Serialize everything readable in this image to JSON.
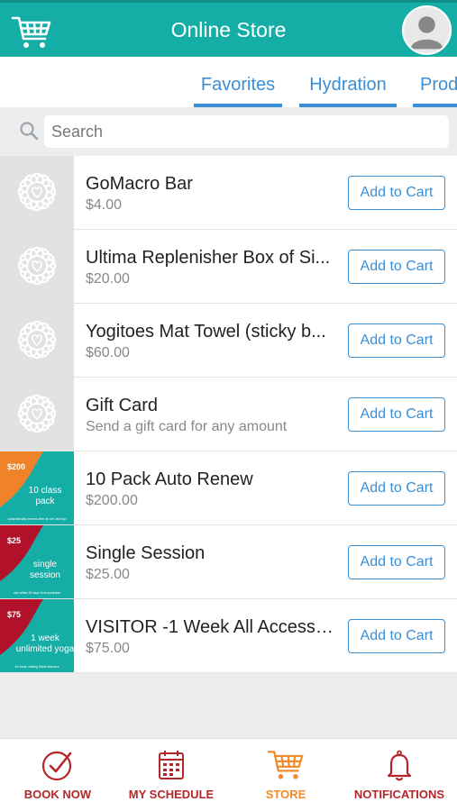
{
  "header": {
    "title": "Online Store"
  },
  "tabs": [
    {
      "label": "Favorites"
    },
    {
      "label": "Hydration"
    },
    {
      "label": "Prod"
    }
  ],
  "search": {
    "placeholder": "Search",
    "value": ""
  },
  "products": [
    {
      "name": "GoMacro Bar",
      "sub": "$4.00",
      "button": "Add to Cart",
      "thumb": "placeholder"
    },
    {
      "name": "Ultima Replenisher Box of Si...",
      "sub": "$20.00",
      "button": "Add to Cart",
      "thumb": "placeholder"
    },
    {
      "name": "Yogitoes Mat Towel (sticky b...",
      "sub": "$60.00",
      "button": "Add to Cart",
      "thumb": "placeholder"
    },
    {
      "name": "Gift Card",
      "sub": "Send a gift card for any amount",
      "button": "Add to Cart",
      "thumb": "placeholder"
    },
    {
      "name": "10 Pack Auto Renew",
      "sub": "$200.00",
      "button": "Add to Cart",
      "thumb": "promo",
      "promo": {
        "price": "$200",
        "line1": "10 class",
        "line2": "pack",
        "fine": "automatically renews after all are used up",
        "accent": "#f0822a"
      }
    },
    {
      "name": "Single Session",
      "sub": "$25.00",
      "button": "Add to Cart",
      "thumb": "promo",
      "promo": {
        "price": "$25",
        "line1": "single",
        "line2": "session",
        "fine": "use within 30 days from purchase",
        "accent": "#b1122a"
      }
    },
    {
      "name": "VISITOR -1 Week All Access P...",
      "sub": "$75.00",
      "button": "Add to Cart",
      "thumb": "promo",
      "promo": {
        "price": "$75",
        "line1": "1 week",
        "line2": "unlimited yoga",
        "fine": "for those visiting Santa Barbara",
        "accent": "#b1122a"
      }
    }
  ],
  "bottom_nav": [
    {
      "label": "BOOK NOW",
      "icon": "check-circle-icon"
    },
    {
      "label": "MY SCHEDULE",
      "icon": "calendar-icon"
    },
    {
      "label": "STORE",
      "icon": "cart-icon",
      "active": true
    },
    {
      "label": "NOTIFICATIONS",
      "icon": "bell-icon"
    }
  ],
  "colors": {
    "teal": "#15aea6",
    "link_blue": "#3a8fd6",
    "nav_red": "#b3262b",
    "nav_orange": "#f28a2a"
  }
}
